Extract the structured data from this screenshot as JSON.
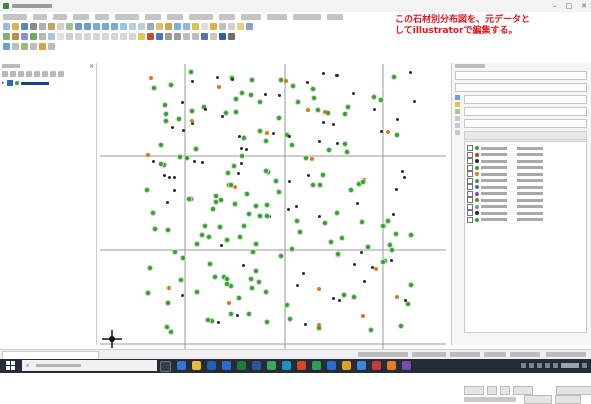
{
  "annotation": {
    "line1": "この石材別分布図を、元データと",
    "line2": "してillustratorで編集する。"
  },
  "window": {
    "minimize_glyph": "–",
    "maximize_glyph": "□",
    "close_glyph": "✕"
  },
  "colors": {
    "annotation": "#e8141e",
    "taskbar": "#252c35",
    "point_green": "#3e9a3a",
    "point_black": "#2b2b2b",
    "point_orange": "#d9781e"
  },
  "map": {
    "grid_columns": 3,
    "grid_rows": 3
  }
}
